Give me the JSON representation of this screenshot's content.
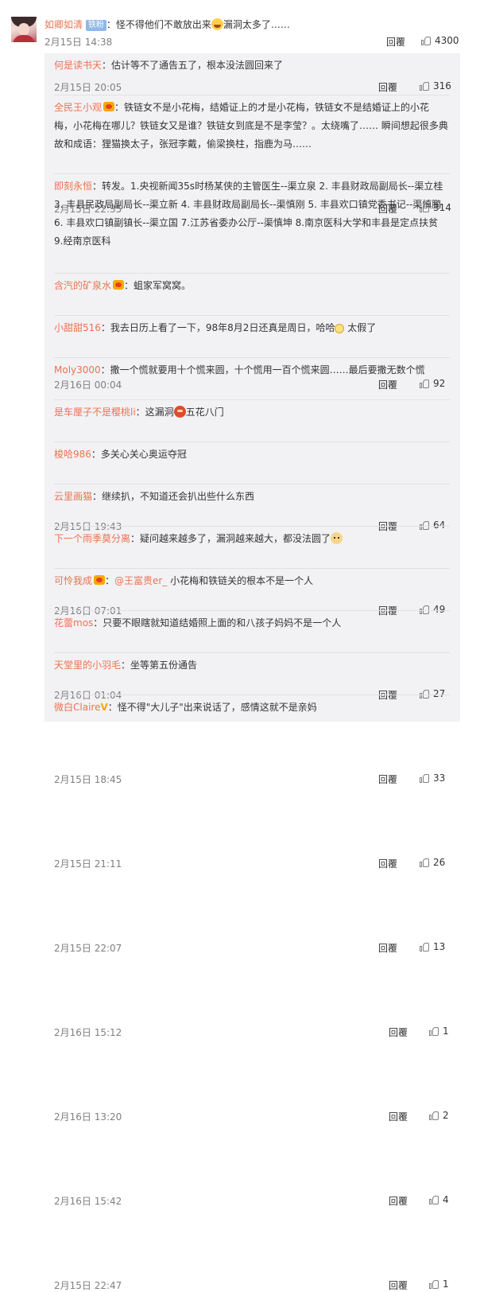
{
  "top": {
    "user": "如卿如清",
    "badge": "铁粉",
    "text_before": "：怪不得他们不敢放出来",
    "emoji": "laugh-emoji",
    "text_after": "漏洞太多了……",
    "date": "2月15日 14:38",
    "reply_label": "回覆",
    "likes": "4300"
  },
  "replies": [
    {
      "user": "何是读书天",
      "text": "：估计等不了通告五了，根本没法圆回来了",
      "date": "2月15日 20:05",
      "reply_label": "回覆",
      "likes": "316"
    },
    {
      "user": "全民王小观",
      "text": "：铁链女不是小花梅，结婚证上的才是小花梅，铁链女不是结婚证上的小花梅，小花梅在哪儿？铁链女又是谁？铁链女到底是不是李莹？。太绕嘴了…… 瞬间想起很多典故和成语：狸猫换太子，张冠李戴，偷梁换柱，指鹿为马……",
      "date": "2月15日 22:35",
      "reply_label": "回覆",
      "likes": "314"
    },
    {
      "user": "即刻永恒",
      "text": "：转发。1.央视新闻35s时杨某侠的主管医生--渠立泉 2. 丰县财政局副局长--渠立桂 3. 丰县民政局副局长--渠立新 4. 丰县财政局副局长--渠慎刚 5. 丰县欢口镇党委书记--渠慎鹏 6. 丰县欢口镇副镇长--渠立国 7.江苏省委办公厅--渠慎坤 8.南京医科大学和丰县是定点扶贫 9.经南京医科",
      "date": "2月16日 00:04",
      "reply_label": "回覆",
      "likes": "92"
    },
    {
      "user": "含汽的矿泉水",
      "text": "：蛆家军窝窝。",
      "date": "2月15日 19:43",
      "reply_label": "回覆",
      "likes": "64"
    },
    {
      "user": "小甜甜516",
      "text": "：我去日历上看了一下，98年8月2日还真是周日，哈哈",
      "text2": " 太假了",
      "date": "2月16日 07:01",
      "reply_label": "回覆",
      "likes": "49"
    },
    {
      "user": "Moly3000",
      "text": "：撒一个慌就要用十个慌来圆，十个慌用一百个慌来圆……最后要撒无数个慌",
      "date": "2月16日 01:04",
      "reply_label": "回覆",
      "likes": "27"
    },
    {
      "user": "是车厘子不是樱桃li",
      "text": "：这漏洞",
      "text2": "五花八门",
      "date": "2月15日 18:45",
      "reply_label": "回覆",
      "likes": "33"
    },
    {
      "user": "梭哈986",
      "text": "：多关心关心奥运夺冠",
      "date": "2月15日 21:11",
      "reply_label": "回覆",
      "likes": "26"
    },
    {
      "user": "云里画猫",
      "text": "：继续扒，不知道还会扒出些什么东西",
      "date": "2月15日 22:07",
      "reply_label": "回覆",
      "likes": "13"
    },
    {
      "user": "下一个雨季莫分离",
      "text": "：疑问越来越多了，漏洞越来越大，都没法圆了",
      "date": "2月16日 15:12",
      "reply_label": "回覆",
      "likes": "1"
    },
    {
      "user": "可怜我成",
      "text": "：",
      "mention": "@王富贵er_",
      "text2": " 小花梅和铁链关的根本不是一个人",
      "date": "2月16日 13:20",
      "reply_label": "回覆",
      "likes": "2"
    },
    {
      "user": "花蕾mos",
      "text": "：只要不眼瞎就知道结婚照上面的和八孩子妈妈不是一个人",
      "date": "2月16日 15:42",
      "reply_label": "回覆",
      "likes": "4"
    },
    {
      "user": "天堂里的小羽毛",
      "text": "：坐等第五份通告",
      "date": "2月15日 22:47",
      "reply_label": "回覆",
      "likes": "1"
    },
    {
      "user": "微白Claire",
      "text": "：怪不得\"大儿子\"出来说话了，感情这就不是亲妈"
    }
  ]
}
